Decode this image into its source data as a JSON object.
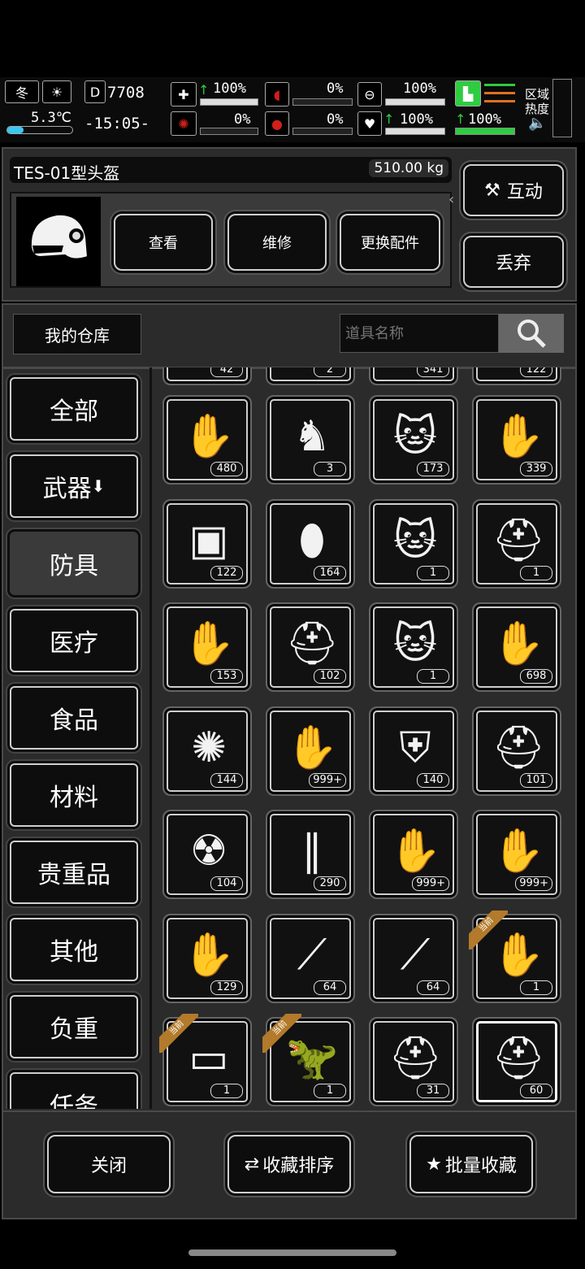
{
  "status": {
    "season": "冬",
    "temperature": "5.3℃",
    "day": "7708",
    "time": "-15:05-",
    "health_pct": "100%",
    "stomach_pct": "0%",
    "water_tank_pct": "100%",
    "infection_pct": "0%",
    "bleeding_pct": "0%",
    "heart_pct": "100%",
    "stamina_pct": "100%",
    "zone_label": "区域",
    "heat_label": "热度"
  },
  "item_panel": {
    "name": "TES-01型头盔",
    "weight": "510.00 kg",
    "view_label": "查看",
    "repair_label": "维修",
    "replace_label": "更换配件",
    "interact_label": "互动",
    "discard_label": "丢弃"
  },
  "warehouse": {
    "title": "我的仓库",
    "search_placeholder": "道具名称"
  },
  "categories": [
    {
      "label": "全部"
    },
    {
      "label": "武器"
    },
    {
      "label": "防具",
      "selected": true
    },
    {
      "label": "医疗"
    },
    {
      "label": "食品"
    },
    {
      "label": "材料"
    },
    {
      "label": "贵重品"
    },
    {
      "label": "其他"
    },
    {
      "label": "负重"
    },
    {
      "label": "任务"
    }
  ],
  "partial_row_counts": [
    "42",
    "2",
    "341",
    "122"
  ],
  "items": [
    {
      "count": "480",
      "icon": "bandaged-arm-guard-icon"
    },
    {
      "count": "3",
      "icon": "horned-cap-icon"
    },
    {
      "count": "173",
      "icon": "cat-hat-icon"
    },
    {
      "count": "339",
      "icon": "glove-icon"
    },
    {
      "count": "122",
      "icon": "vest-icon"
    },
    {
      "count": "164",
      "icon": "knee-pads-icon"
    },
    {
      "count": "1",
      "icon": "cat-hat-icon"
    },
    {
      "count": "1",
      "icon": "tactical-helmet-icon"
    },
    {
      "count": "153",
      "icon": "fingerless-glove-icon"
    },
    {
      "count": "102",
      "icon": "army-helmet-icon"
    },
    {
      "count": "1",
      "icon": "cat-hat-icon"
    },
    {
      "count": "698",
      "icon": "tactical-glove-icon"
    },
    {
      "count": "144",
      "icon": "fur-gauntlet-icon"
    },
    {
      "count": "999+",
      "icon": "fingerless-gloves-icon"
    },
    {
      "count": "140",
      "icon": "chest-armor-icon"
    },
    {
      "count": "101",
      "icon": "pilot-helmet-icon"
    },
    {
      "count": "104",
      "icon": "gas-mask-icon"
    },
    {
      "count": "290",
      "icon": "arm-sleeves-icon"
    },
    {
      "count": "999+",
      "icon": "riding-glove-icon"
    },
    {
      "count": "999+",
      "icon": "studded-gloves-icon"
    },
    {
      "count": "129",
      "icon": "claw-gloves-icon"
    },
    {
      "count": "64",
      "icon": "leg-brace-icon"
    },
    {
      "count": "64",
      "icon": "leg-brace-icon"
    },
    {
      "count": "1",
      "icon": "scale-gloves-icon",
      "tag": "当前"
    },
    {
      "count": "1",
      "icon": "shorts-icon",
      "tag": "当前"
    },
    {
      "count": "1",
      "icon": "dinosaur-hood-icon",
      "tag": "当前"
    },
    {
      "count": "31",
      "icon": "tactical-helmet-icon"
    },
    {
      "count": "60",
      "icon": "tactical-helmet-icon",
      "selected": true
    }
  ],
  "footer": {
    "close_label": "关闭",
    "sort_label": "收藏排序",
    "batch_label": "批量收藏"
  },
  "colors": {
    "background": "#000000",
    "panel": "#2b2b2b",
    "health_green": "#2ecc40",
    "danger_red": "#d0201a",
    "tag_orange": "#b27a2a",
    "stamina_bar_orange": "#e07020"
  }
}
